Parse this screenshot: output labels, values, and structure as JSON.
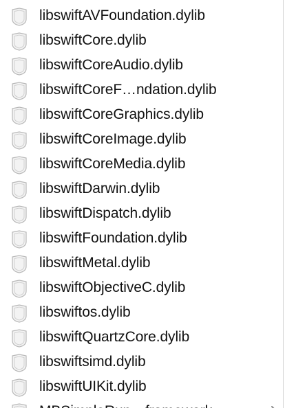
{
  "files": [
    {
      "name": "libswiftAVFoundation.dylib",
      "icon": "dylib-file-icon"
    },
    {
      "name": "libswiftCore.dylib",
      "icon": "dylib-file-icon"
    },
    {
      "name": "libswiftCoreAudio.dylib",
      "icon": "dylib-file-icon"
    },
    {
      "name": "libswiftCoreF…ndation.dylib",
      "icon": "dylib-file-icon"
    },
    {
      "name": "libswiftCoreGraphics.dylib",
      "icon": "dylib-file-icon"
    },
    {
      "name": "libswiftCoreImage.dylib",
      "icon": "dylib-file-icon"
    },
    {
      "name": "libswiftCoreMedia.dylib",
      "icon": "dylib-file-icon"
    },
    {
      "name": "libswiftDarwin.dylib",
      "icon": "dylib-file-icon"
    },
    {
      "name": "libswiftDispatch.dylib",
      "icon": "dylib-file-icon"
    },
    {
      "name": "libswiftFoundation.dylib",
      "icon": "dylib-file-icon"
    },
    {
      "name": "libswiftMetal.dylib",
      "icon": "dylib-file-icon"
    },
    {
      "name": "libswiftObjectiveC.dylib",
      "icon": "dylib-file-icon"
    },
    {
      "name": "libswiftos.dylib",
      "icon": "dylib-file-icon"
    },
    {
      "name": "libswiftQuartzCore.dylib",
      "icon": "dylib-file-icon"
    },
    {
      "name": "libswiftsimd.dylib",
      "icon": "dylib-file-icon"
    },
    {
      "name": "libswiftUIKit.dylib",
      "icon": "dylib-file-icon"
    },
    {
      "name": "MBSimpleRun…framework",
      "icon": "framework-icon",
      "disclosure": true
    }
  ]
}
